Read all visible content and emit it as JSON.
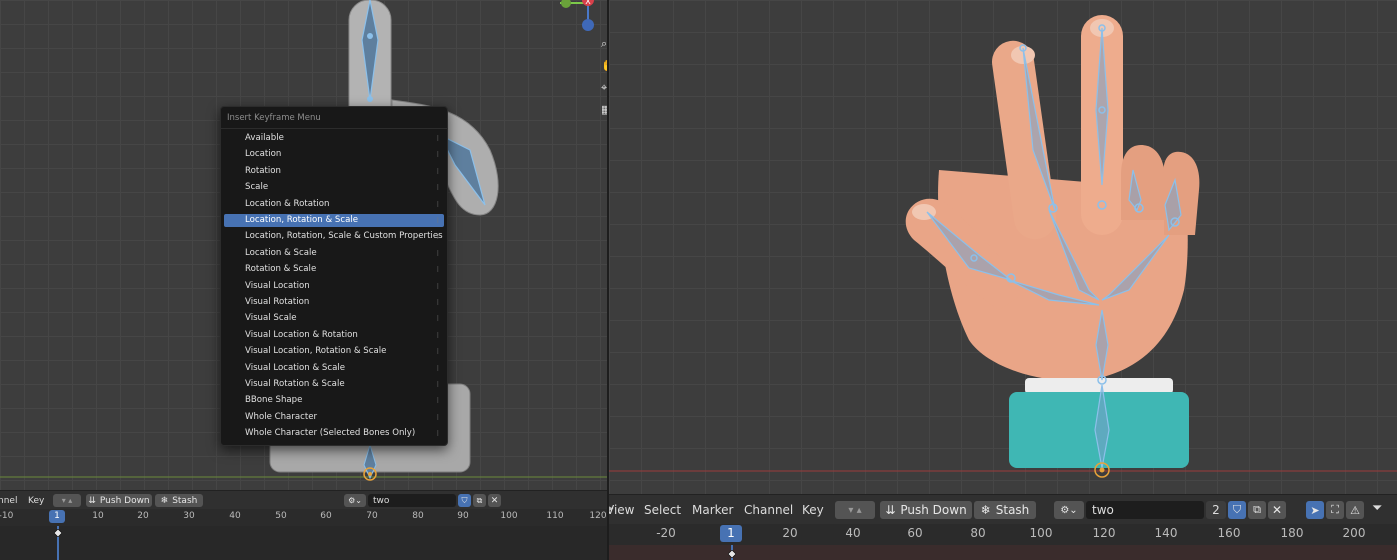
{
  "popup": {
    "title": "Insert Keyframe Menu",
    "items": [
      {
        "label": "Available"
      },
      {
        "label": "Location"
      },
      {
        "label": "Rotation"
      },
      {
        "label": "Scale"
      },
      {
        "label": "Location & Rotation"
      },
      {
        "label": "Location, Rotation & Scale"
      },
      {
        "label": "Location, Rotation, Scale & Custom Properties"
      },
      {
        "label": "Location & Scale"
      },
      {
        "label": "Rotation & Scale"
      },
      {
        "label": "Visual Location"
      },
      {
        "label": "Visual Rotation"
      },
      {
        "label": "Visual Scale"
      },
      {
        "label": "Visual Location & Rotation"
      },
      {
        "label": "Visual Location, Rotation & Scale"
      },
      {
        "label": "Visual Location & Scale"
      },
      {
        "label": "Visual Rotation & Scale"
      },
      {
        "label": "BBone Shape"
      },
      {
        "label": "Whole Character"
      },
      {
        "label": "Whole Character (Selected Bones Only)"
      }
    ],
    "selected_index": 5,
    "item_marker": "⁝"
  },
  "left_header": {
    "menus": [
      "nnel",
      "Key"
    ],
    "push_down": "Push Down",
    "stash": "Stash",
    "action_name": "two"
  },
  "left_ruler": {
    "ticks": [
      "-10",
      "1",
      "10",
      "20",
      "30",
      "40",
      "50",
      "60",
      "70",
      "80",
      "90",
      "100",
      "110",
      "120"
    ],
    "current_frame": "1"
  },
  "right_header": {
    "menus": [
      "View",
      "Select",
      "Marker",
      "Channel",
      "Key"
    ],
    "push_down": "Push Down",
    "stash": "Stash",
    "action_name": "two",
    "user_count": "2"
  },
  "right_ruler": {
    "ticks": [
      "-20",
      "1",
      "20",
      "40",
      "60",
      "80",
      "100",
      "120",
      "140",
      "160",
      "180",
      "200"
    ],
    "current_frame": "1"
  },
  "gizmo": {
    "x_axis_label": "X"
  },
  "colors": {
    "accent": "#4772b3",
    "skin": "#e9a587",
    "cuff": "#3fb7b4",
    "bone": "#7fb0d8",
    "model_grey": "#b3b3b3"
  }
}
